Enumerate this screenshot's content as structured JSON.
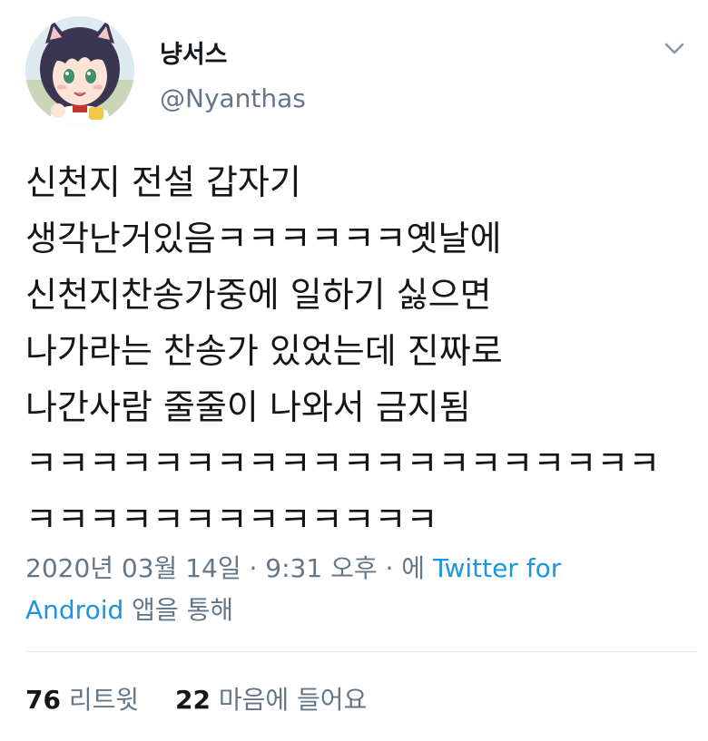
{
  "user": {
    "display_name": "냥서스",
    "handle": "@Nyanthas"
  },
  "tweet": {
    "lines": [
      "신천지 전설 갑자기",
      "생각난거있음ㅋㅋㅋㅋㅋㅋ옛날에",
      "신천지찬송가중에 일하기 싫으면",
      "나가라는 찬송가 있었는데 진짜로",
      "나간사람 줄줄이 나와서 금지됨",
      "ㅋㅋㅋㅋㅋㅋㅋㅋㅋㅋㅋㅋㅋㅋㅋㅋㅋㅋㅋㅋ",
      "ㅋㅋㅋㅋㅋㅋㅋㅋㅋㅋㅋㅋㅋ"
    ]
  },
  "meta": {
    "timestamp": "2020년 03월 14일 · 9:31 오후 · 에 ",
    "source_part1": "Twitter for",
    "source_part2": "Android",
    "via_suffix": " 앱을 통해"
  },
  "stats": {
    "retweets_count": "76",
    "retweets_label": "리트윗",
    "likes_count": "22",
    "likes_label": "마음에 들어요"
  },
  "icons": {
    "menu": "chevron-down-icon",
    "avatar": "anime-avatar-image"
  },
  "colors": {
    "link": "#1b95e0",
    "secondary_text": "#657786",
    "primary_text": "#14171a",
    "divider": "#e1e8ed"
  }
}
